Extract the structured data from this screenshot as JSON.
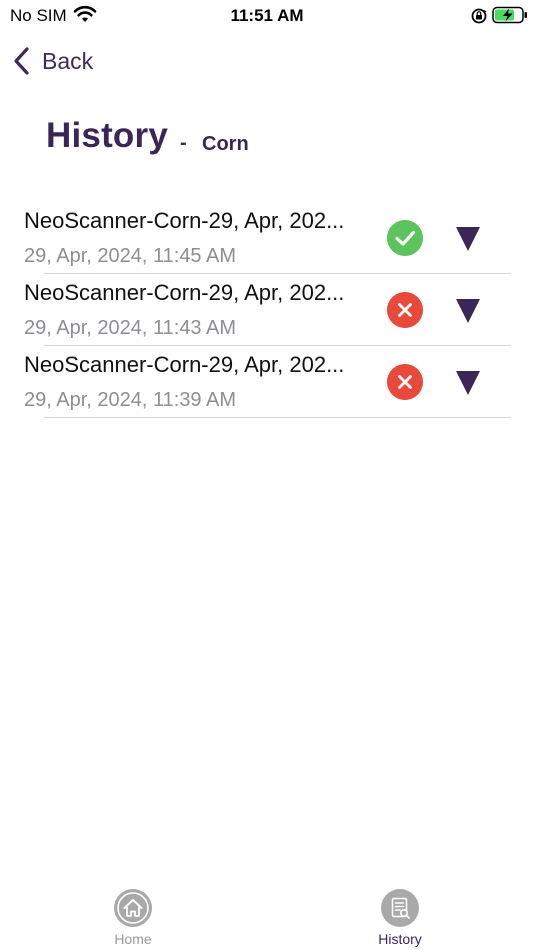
{
  "status_bar": {
    "carrier": "No SIM",
    "time": "11:51 AM",
    "icons": [
      "wifi-icon",
      "orientation-lock-icon",
      "battery-charging-icon"
    ]
  },
  "nav": {
    "back_label": "Back"
  },
  "header": {
    "title": "History",
    "separator": "-",
    "subtitle": "Corn"
  },
  "history": {
    "items": [
      {
        "title": "NeoScanner-Corn-29, Apr, 202...",
        "date": "29, Apr, 2024, 11:45 AM",
        "status": "success",
        "status_icon": "check-icon",
        "status_color": "#5cc45c"
      },
      {
        "title": "NeoScanner-Corn-29, Apr, 202...",
        "date": "29, Apr, 2024, 11:43 AM",
        "status": "fail",
        "status_icon": "x-icon",
        "status_color": "#e8493a"
      },
      {
        "title": "NeoScanner-Corn-29, Apr, 202...",
        "date": "29, Apr, 2024, 11:39 AM",
        "status": "fail",
        "status_icon": "x-icon",
        "status_color": "#e8493a"
      }
    ]
  },
  "tab_bar": {
    "tabs": [
      {
        "label": "Home",
        "icon": "home-icon",
        "active": false
      },
      {
        "label": "History",
        "icon": "history-document-icon",
        "active": true
      }
    ]
  },
  "colors": {
    "accent": "#3a2657",
    "success": "#5cc45c",
    "error": "#e8493a",
    "muted_text": "#8e8e93"
  }
}
